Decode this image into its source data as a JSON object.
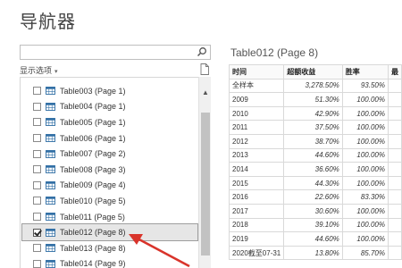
{
  "window": {
    "title": "导航器"
  },
  "search": {
    "placeholder": "",
    "value": "",
    "icon": "search-icon"
  },
  "display_options": {
    "label": "显示选项",
    "caret": "▾"
  },
  "nav_items": [
    {
      "label": "Table003 (Page 1)",
      "checked": false,
      "selected": false
    },
    {
      "label": "Table004 (Page 1)",
      "checked": false,
      "selected": false
    },
    {
      "label": "Table005 (Page 1)",
      "checked": false,
      "selected": false
    },
    {
      "label": "Table006 (Page 1)",
      "checked": false,
      "selected": false
    },
    {
      "label": "Table007 (Page 2)",
      "checked": false,
      "selected": false
    },
    {
      "label": "Table008 (Page 3)",
      "checked": false,
      "selected": false
    },
    {
      "label": "Table009 (Page 4)",
      "checked": false,
      "selected": false
    },
    {
      "label": "Table010 (Page 5)",
      "checked": false,
      "selected": false
    },
    {
      "label": "Table011 (Page 5)",
      "checked": false,
      "selected": false
    },
    {
      "label": "Table012 (Page 8)",
      "checked": true,
      "selected": true
    },
    {
      "label": "Table013 (Page 8)",
      "checked": false,
      "selected": false
    },
    {
      "label": "Table014 (Page 9)",
      "checked": false,
      "selected": false
    }
  ],
  "scroll_up_glyph": "▲",
  "preview": {
    "title": "Table012 (Page 8)",
    "headers": [
      "时间",
      "超额收益",
      "胜率",
      "最"
    ],
    "rows": [
      [
        "全样本",
        "3,278.50%",
        "93.50%",
        ""
      ],
      [
        "2009",
        "51.30%",
        "100.00%",
        ""
      ],
      [
        "2010",
        "42.90%",
        "100.00%",
        ""
      ],
      [
        "2011",
        "37.50%",
        "100.00%",
        ""
      ],
      [
        "2012",
        "38.70%",
        "100.00%",
        ""
      ],
      [
        "2013",
        "44.60%",
        "100.00%",
        ""
      ],
      [
        "2014",
        "36.60%",
        "100.00%",
        ""
      ],
      [
        "2015",
        "44.30%",
        "100.00%",
        ""
      ],
      [
        "2016",
        "22.60%",
        "83.30%",
        ""
      ],
      [
        "2017",
        "30.60%",
        "100.00%",
        ""
      ],
      [
        "2018",
        "39.10%",
        "100.00%",
        ""
      ],
      [
        "2019",
        "44.60%",
        "100.00%",
        ""
      ],
      [
        "2020截至07-31",
        "13.80%",
        "85.70%",
        ""
      ]
    ]
  },
  "colors": {
    "arrow": "#d9342b",
    "selected_bg": "#e6e6e6",
    "table_icon": "#2e6da4"
  }
}
